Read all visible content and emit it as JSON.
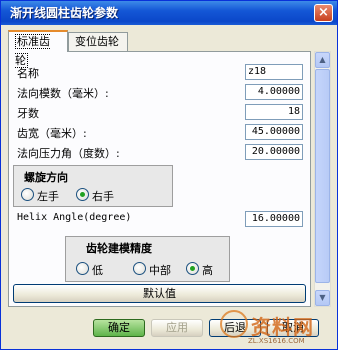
{
  "window": {
    "title": "渐开线圆柱齿轮参数",
    "close_glyph": "×"
  },
  "tabs": [
    {
      "label": "标准齿轮",
      "active": true
    },
    {
      "label": "变位齿轮",
      "active": false
    }
  ],
  "fields": [
    {
      "label": "名称",
      "value": "z18"
    },
    {
      "label": "法向模数（毫米）:",
      "value": "4.00000"
    },
    {
      "label": "牙数",
      "value": "18"
    },
    {
      "label": "齿宽（毫米）:",
      "value": "45.00000"
    },
    {
      "label": "法向压力角（度数）:",
      "value": "20.00000"
    }
  ],
  "helix_direction": {
    "title": "螺旋方向",
    "options": [
      {
        "label": "左手",
        "selected": false
      },
      {
        "label": "右手",
        "selected": true
      }
    ]
  },
  "helix_angle": {
    "label": "Helix Angle(degree)",
    "value": "16.00000"
  },
  "modeling_precision": {
    "title": "齿轮建模精度",
    "options": [
      {
        "label": "低",
        "selected": false
      },
      {
        "label": "中部",
        "selected": false
      },
      {
        "label": "高",
        "selected": true
      }
    ]
  },
  "default_button": "默认值",
  "footer": {
    "ok": "确定",
    "apply": "应用",
    "back": "后退",
    "cancel": "取消"
  },
  "watermark": {
    "text": "资料网",
    "url": "ZL.XS1616.COM"
  },
  "colors": {
    "title_bar": "#1457d6",
    "radio_on": "#21a121",
    "tab_highlight": "#e68b2c"
  }
}
